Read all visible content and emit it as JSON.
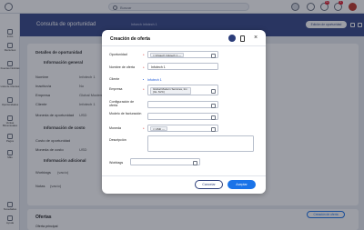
{
  "topbar": {
    "search_placeholder": "Buscar",
    "badges": [
      "9+",
      "1"
    ]
  },
  "leftnav": {
    "items": [
      "Inicio",
      "Recientes",
      "Fuentes Noticias",
      "Lista de Clientes",
      "Oportunidades",
      "Ventas Bimensuales",
      "Pagos",
      "Más",
      "Novedades",
      "Ayuda"
    ]
  },
  "header": {
    "title": "Consulta de oportunidad",
    "record": "Infoech Infotech 1",
    "edit_button": "Edición de oportunidad"
  },
  "background": {
    "section_title": "Detalles de oportunidad",
    "general_title": "Información general",
    "fields": [
      {
        "label": "Nombre",
        "value": "Infotech 1"
      },
      {
        "label": "Inactivo/a",
        "value": "No"
      },
      {
        "label": "Empresa",
        "value": "Global Modern"
      },
      {
        "label": "Cliente",
        "value": "Infotech 1"
      },
      {
        "label": "Moneda de oportunidad",
        "value": "USD"
      }
    ],
    "cost_title": "Información de costo",
    "cost_fields": [
      {
        "label": "Costo de oportunidad",
        "value": ""
      },
      {
        "label": "Moneda de costo",
        "value": "USD"
      }
    ],
    "extra_title": "Información adicional",
    "extra_fields": [
      {
        "label": "Worktags",
        "value": "(vacío)"
      },
      {
        "label": "Notas",
        "value": "(vacío)"
      }
    ],
    "bottom_title": "Ofertas",
    "bottom_label": "Oferta principal",
    "bottom_button": "Creación de oferta"
  },
  "modal": {
    "title": "Creación de oferta",
    "fields": {
      "oportunidad": {
        "label": "Oportunidad",
        "value": "Infotech Infotech 1"
      },
      "nombre": {
        "label": "Nombre de oferta",
        "value": "Infotech 1"
      },
      "cliente": {
        "label": "Cliente",
        "value": "Infotech 1"
      },
      "empresa": {
        "label": "Empresa",
        "value": "Global Modern Services, Inc. (GL SVC)"
      },
      "configuracion": {
        "label": "Configuración de oferta",
        "value": ""
      },
      "modelo": {
        "label": "Modelo de facturación",
        "value": ""
      },
      "moneda": {
        "label": "Moneda",
        "value": "USD"
      },
      "descripcion": {
        "label": "Descripción",
        "value": ""
      },
      "worktags": {
        "label": "Worktags",
        "value": ""
      }
    },
    "cancel": "Cancelar",
    "accept": "Aceptar"
  }
}
